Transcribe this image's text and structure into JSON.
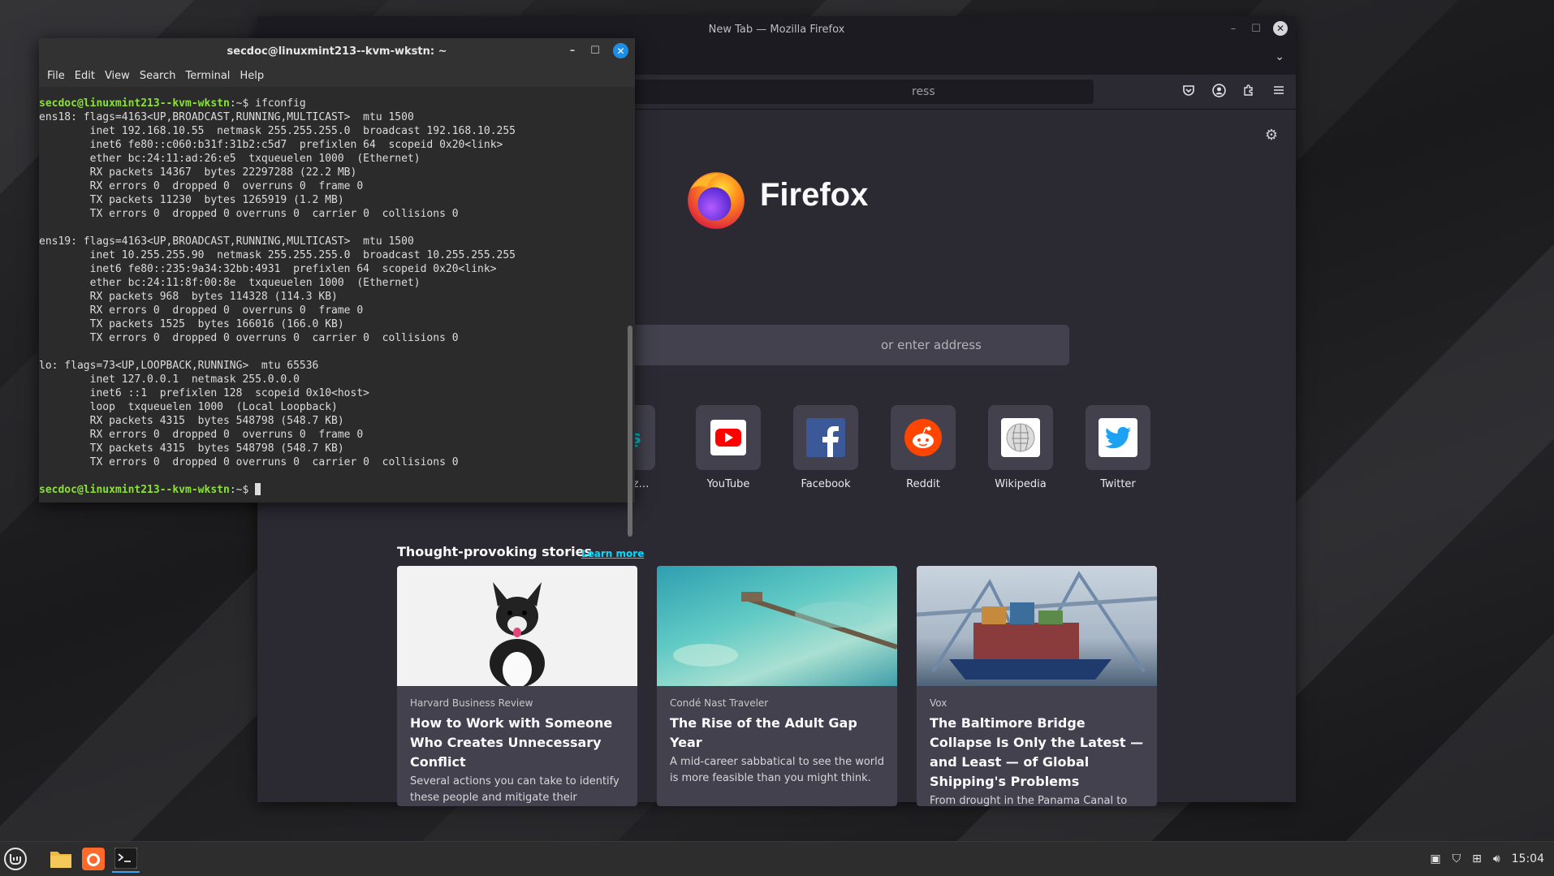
{
  "firefox": {
    "window_title": "New Tab — Mozilla Firefox",
    "url_placeholder": "ress",
    "brand": "Firefox",
    "search_placeholder": "or enter address",
    "shortcuts": [
      {
        "label": "moz…",
        "icon": "mozilla-icon"
      },
      {
        "label": "YouTube",
        "icon": "youtube-icon"
      },
      {
        "label": "Facebook",
        "icon": "facebook-icon"
      },
      {
        "label": "Reddit",
        "icon": "reddit-icon"
      },
      {
        "label": "Wikipedia",
        "icon": "wikipedia-icon"
      },
      {
        "label": "Twitter",
        "icon": "twitter-icon"
      }
    ],
    "stories_heading": "Thought-provoking stories",
    "stories_link": "Learn more",
    "stories": [
      {
        "source": "Harvard Business Review",
        "title": "How to Work with Someone Who Creates Unnecessary Conflict",
        "desc": "Several actions you can take to identify these people and mitigate their negative"
      },
      {
        "source": "Condé Nast Traveler",
        "title": "The Rise of the Adult Gap Year",
        "desc": "A mid-career sabbatical to see the world is more feasible than you might think."
      },
      {
        "source": "Vox",
        "title": "The Baltimore Bridge Collapse Is Only the Latest — and Least — of Global Shipping's Problems",
        "desc": "From drought in the Panama Canal to the Houthis in the Suez to pirates off"
      }
    ]
  },
  "terminal": {
    "window_title": "secdoc@linuxmint213--kvm-wkstn: ~",
    "menu": [
      "File",
      "Edit",
      "View",
      "Search",
      "Terminal",
      "Help"
    ],
    "prompt": "secdoc@linuxmint213--kvm-wkstn",
    "prompt_suffix": ":~$ ",
    "command": "ifconfig",
    "output": [
      "ens18: flags=4163<UP,BROADCAST,RUNNING,MULTICAST>  mtu 1500",
      "        inet 192.168.10.55  netmask 255.255.255.0  broadcast 192.168.10.255",
      "        inet6 fe80::c060:b31f:31b2:c5d7  prefixlen 64  scopeid 0x20<link>",
      "        ether bc:24:11:ad:26:e5  txqueuelen 1000  (Ethernet)",
      "        RX packets 14367  bytes 22297288 (22.2 MB)",
      "        RX errors 0  dropped 0  overruns 0  frame 0",
      "        TX packets 11230  bytes 1265919 (1.2 MB)",
      "        TX errors 0  dropped 0 overruns 0  carrier 0  collisions 0",
      "",
      "ens19: flags=4163<UP,BROADCAST,RUNNING,MULTICAST>  mtu 1500",
      "        inet 10.255.255.90  netmask 255.255.255.0  broadcast 10.255.255.255",
      "        inet6 fe80::235:9a34:32bb:4931  prefixlen 64  scopeid 0x20<link>",
      "        ether bc:24:11:8f:00:8e  txqueuelen 1000  (Ethernet)",
      "        RX packets 968  bytes 114328 (114.3 KB)",
      "        RX errors 0  dropped 0  overruns 0  frame 0",
      "        TX packets 1525  bytes 166016 (166.0 KB)",
      "        TX errors 0  dropped 0 overruns 0  carrier 0  collisions 0",
      "",
      "lo: flags=73<UP,LOOPBACK,RUNNING>  mtu 65536",
      "        inet 127.0.0.1  netmask 255.0.0.0",
      "        inet6 ::1  prefixlen 128  scopeid 0x10<host>",
      "        loop  txqueuelen 1000  (Local Loopback)",
      "        RX packets 4315  bytes 548798 (548.7 KB)",
      "        RX errors 0  dropped 0  overruns 0  frame 0",
      "        TX packets 4315  bytes 548798 (548.7 KB)",
      "        TX errors 0  dropped 0 overruns 0  carrier 0  collisions 0",
      ""
    ]
  },
  "taskbar": {
    "clock": "15:04"
  }
}
